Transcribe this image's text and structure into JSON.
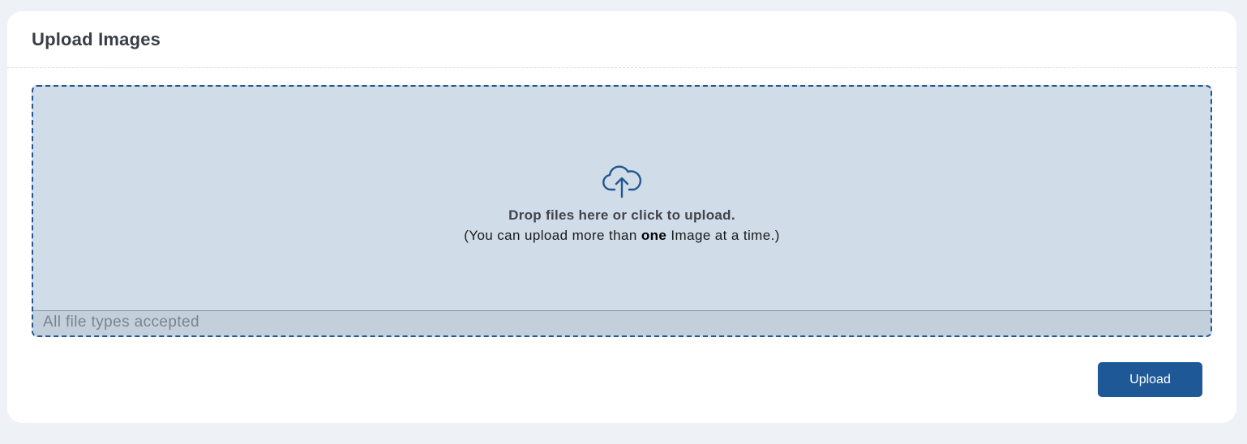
{
  "card": {
    "title": "Upload Images"
  },
  "dropzone": {
    "icon": "cloud-upload-icon",
    "title": "Drop files here or click to upload.",
    "sub_before": "(You can upload more than ",
    "sub_bold": "one",
    "sub_after": " Image at a time.)",
    "footer_text": "All file types accepted"
  },
  "actions": {
    "upload_label": "Upload"
  },
  "colors": {
    "accent": "#1e5896",
    "dropzone_bg": "#d0dce8",
    "dropzone_border": "#23578f",
    "page_bg": "#eef1f5"
  }
}
